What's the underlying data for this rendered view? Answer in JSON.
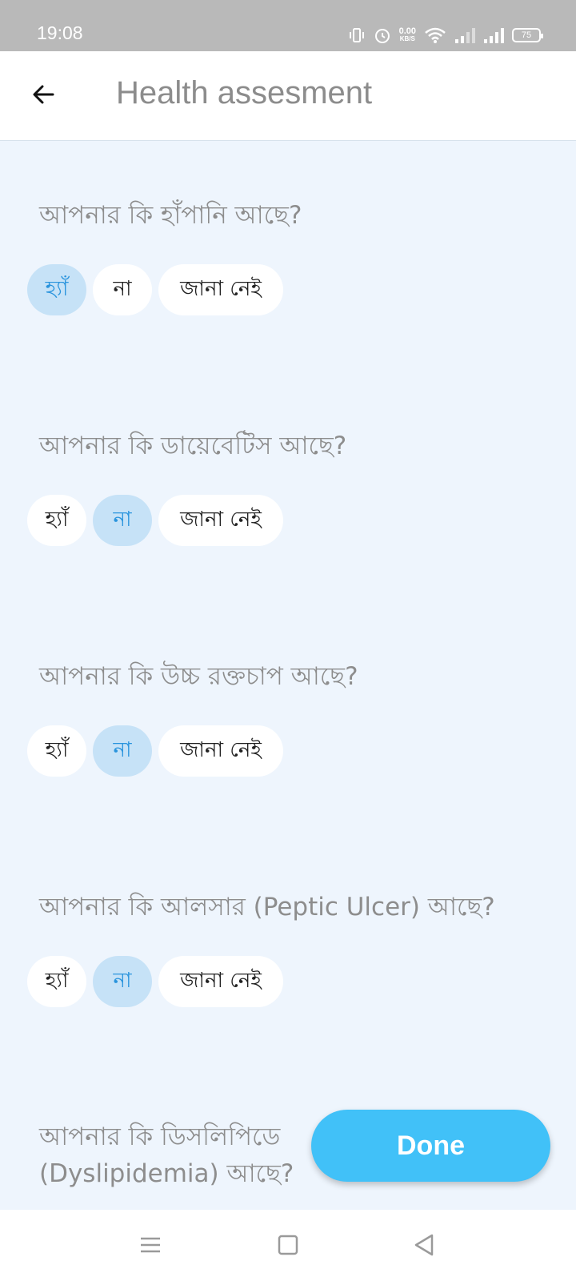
{
  "status_bar": {
    "time": "19:08",
    "net_speed_value": "0.00",
    "net_speed_unit": "KB/S",
    "battery_level": "75",
    "icons": [
      "vibrate-icon",
      "alarm-icon",
      "wifi-icon",
      "signal-icon",
      "signal-icon",
      "battery-icon"
    ]
  },
  "app_bar": {
    "title": "Health assesment",
    "back_icon": "arrow-left-icon"
  },
  "questions": [
    {
      "text": "আপনার কি হাঁপানি আছে?",
      "options": [
        "হ্যাঁ",
        "না",
        "জানা নেই"
      ],
      "selected": "হ্যাঁ"
    },
    {
      "text": "আপনার কি ডায়েবেটিস আছে?",
      "options": [
        "হ্যাঁ",
        "না",
        "জানা নেই"
      ],
      "selected": "না"
    },
    {
      "text": "আপনার কি উচ্চ রক্তচাপ আছে?",
      "options": [
        "হ্যাঁ",
        "না",
        "জানা নেই"
      ],
      "selected": "না"
    },
    {
      "text": "আপনার কি আলসার (Peptic Ulcer) আছে?",
      "options": [
        "হ্যাঁ",
        "না",
        "জানা নেই"
      ],
      "selected": "না"
    },
    {
      "text_line1": "আপনার কি ডিসলিপিডে",
      "text_line2": "(Dyslipidemia) আছে?"
    }
  ],
  "done_button": {
    "label": "Done"
  },
  "colors": {
    "background": "#eef5fd",
    "chip_selected_bg": "#c6e2f7",
    "chip_selected_text": "#2a94dd",
    "done_button": "#41c1f8"
  },
  "nav_bar": {
    "icons": [
      "menu-icon",
      "home-square-icon",
      "back-triangle-icon"
    ]
  }
}
